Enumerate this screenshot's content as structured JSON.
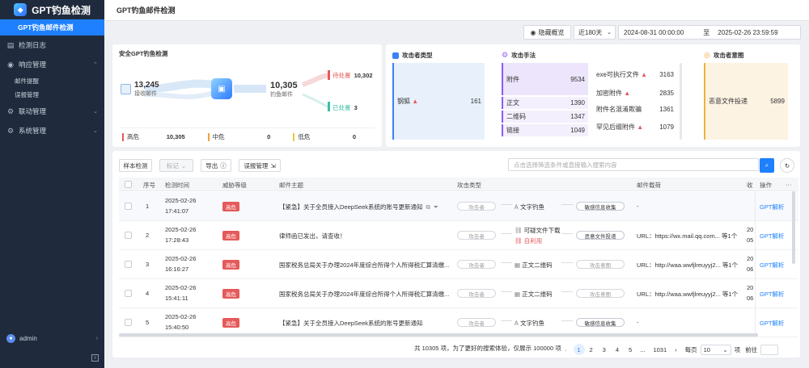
{
  "app": {
    "title": "GPT钓鱼检测"
  },
  "sidebar": {
    "active": "GPT钓鱼邮件检测",
    "items": [
      {
        "label": "检测日志",
        "icon": "log-icon"
      },
      {
        "label": "响应管理",
        "icon": "response-icon",
        "expanded": true,
        "children": [
          "邮件提醒",
          "误报管理"
        ]
      },
      {
        "label": "联动管理",
        "icon": "link-icon"
      },
      {
        "label": "系统管理",
        "icon": "settings-icon"
      }
    ],
    "user": "admin"
  },
  "header": {
    "title": "GPT钓鱼邮件检测"
  },
  "filters": {
    "hide_overview": "隐藏概览",
    "range": "近180天",
    "start": "2024-08-31 00:00:00",
    "to": "至",
    "end": "2025-02-26 23:59:59"
  },
  "overview": {
    "title": "安全GPT钓鱼检测",
    "received_count": "13,245",
    "received_label": "接收邮件",
    "phish_count": "10,305",
    "phish_label": "钓鱼邮件",
    "pending_label": "待处置",
    "pending_count": "10,302",
    "done_label": "已处置",
    "done_count": "3",
    "risks": [
      {
        "label": "高危",
        "value": "10,305",
        "color": "#e55a5a"
      },
      {
        "label": "中危",
        "value": "0",
        "color": "#f0a040"
      },
      {
        "label": "低危",
        "value": "0",
        "color": "#f0c840"
      }
    ]
  },
  "attacker_type": {
    "title": "攻击者类型",
    "items": [
      {
        "label": "钢狐",
        "value": "161"
      }
    ]
  },
  "attack_method": {
    "title": "攻击手法",
    "left": [
      {
        "label": "附件",
        "value": "9534"
      },
      {
        "label": "正文",
        "value": "1390"
      },
      {
        "label": "二维码",
        "value": "1347"
      },
      {
        "label": "链接",
        "value": "1049"
      }
    ],
    "right": [
      {
        "label": "exe可执行文件",
        "value": "3163"
      },
      {
        "label": "加密附件",
        "value": "2835"
      },
      {
        "label": "附件名混淆欺骗",
        "value": "1361"
      },
      {
        "label": "罕见后缀附件",
        "value": "1079"
      }
    ]
  },
  "attack_intent": {
    "title": "攻击者意图",
    "items": [
      {
        "label": "恶意文件投递",
        "value": "5899"
      }
    ]
  },
  "toolbar": {
    "sample": "样本检测",
    "mark": "标记",
    "export": "导出",
    "false_alarm": "误报管理",
    "search_placeholder": "点击选择筛选条件或直接输入搜索内容"
  },
  "table": {
    "headers": [
      "序号",
      "检测时间",
      "威胁等级",
      "邮件主题",
      "攻击类型",
      "邮件载荷",
      "收",
      "操作"
    ],
    "rows": [
      {
        "no": "1",
        "date": "2025-02-26",
        "time": "17:41:07",
        "level": "高危",
        "subject": "【紧急】关于全员接入DeepSeek系统的账号更新通知",
        "attacker": "攻击者",
        "method": "文字钓鱼",
        "method2": "",
        "intent": "敏感信息收集",
        "intent_on": true,
        "payload": "-",
        "recv": "",
        "recv2": "",
        "op": "GPT解析"
      },
      {
        "no": "2",
        "date": "2025-02-26",
        "time": "17:28:43",
        "level": "高危",
        "subject": "律师函已发出，请查收！",
        "attacker": "攻击者",
        "method": "可疑文件下载",
        "method2": "自利用",
        "intent": "恶意文件投递",
        "intent_on": true,
        "payload": "URL：https://wx.mail.qq.com... 等1个",
        "recv": "20",
        "recv2": "05",
        "op": "GPT解析"
      },
      {
        "no": "3",
        "date": "2025-02-26",
        "time": "16:16:27",
        "level": "高危",
        "subject": "国家税务总局关于办理2024年度综合所得个人所得税汇算清缴...",
        "attacker": "攻击者",
        "method": "正文二维码",
        "method2": "",
        "intent": "攻击意图",
        "intent_on": false,
        "payload": "URL：http://waa.wwfjlreuyyj2... 等1个",
        "recv": "20",
        "recv2": "06",
        "op": "GPT解析"
      },
      {
        "no": "4",
        "date": "2025-02-26",
        "time": "15:41:11",
        "level": "高危",
        "subject": "国家税务总局关于办理2024年度综合所得个人所得税汇算清缴...",
        "attacker": "攻击者",
        "method": "正文二维码",
        "method2": "",
        "intent": "攻击意图",
        "intent_on": false,
        "payload": "URL：http://waa.wwfjlreuyyj2... 等1个",
        "recv": "20",
        "recv2": "06",
        "op": "GPT解析"
      },
      {
        "no": "5",
        "date": "2025-02-26",
        "time": "15:40:50",
        "level": "高危",
        "subject": "【紧急】关于全员接入DeepSeek系统的账号更新通知",
        "attacker": "攻击者",
        "method": "文字钓鱼",
        "method2": "",
        "intent": "敏感信息收集",
        "intent_on": true,
        "payload": "-",
        "recv": "",
        "recv2": "",
        "op": "GPT解析"
      }
    ]
  },
  "pager": {
    "summary": "共 10305 项，为了更好的搜索体验，仅展示 100000 项",
    "pages": [
      "1",
      "2",
      "3",
      "4",
      "5",
      "...",
      "1031"
    ],
    "per_page_label": "每页",
    "per_page": "10",
    "unit": "项",
    "goto": "前往"
  }
}
